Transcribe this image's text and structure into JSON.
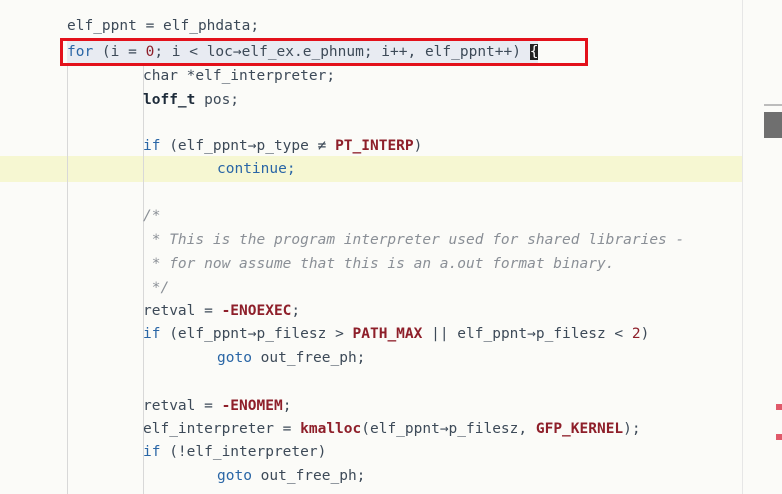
{
  "code": {
    "lines": [
      "elf_ppnt = elf_phdata;",
      "for (i = 0; i < loc→elf_ex.e_phnum; i++, elf_ppnt++) {",
      "char *elf_interpreter;",
      "loff_t pos;",
      "",
      "if (elf_ppnt→p_type ≠ PT_INTERP)",
      "continue;",
      "",
      "/*",
      " * This is the program interpreter used for shared libraries -",
      " * for now assume that this is an a.out format binary.",
      " */",
      "retval = -ENOEXEC;",
      "if (elf_ppnt→p_filesz > PATH_MAX || elf_ppnt→p_filesz < 2)",
      "goto out_free_ph;",
      "",
      "retval = -ENOMEM;",
      "elf_interpreter = kmalloc(elf_ppnt→p_filesz, GFP_KERNEL);",
      "if (!elf_interpreter)",
      "goto out_free_ph;"
    ]
  },
  "colors": {
    "keyword": "#2a66a6",
    "macro": "#8e1f2a",
    "comment": "#8a8f96",
    "highlight_box": "#e3111b",
    "current_line": "#f6f7d2"
  }
}
